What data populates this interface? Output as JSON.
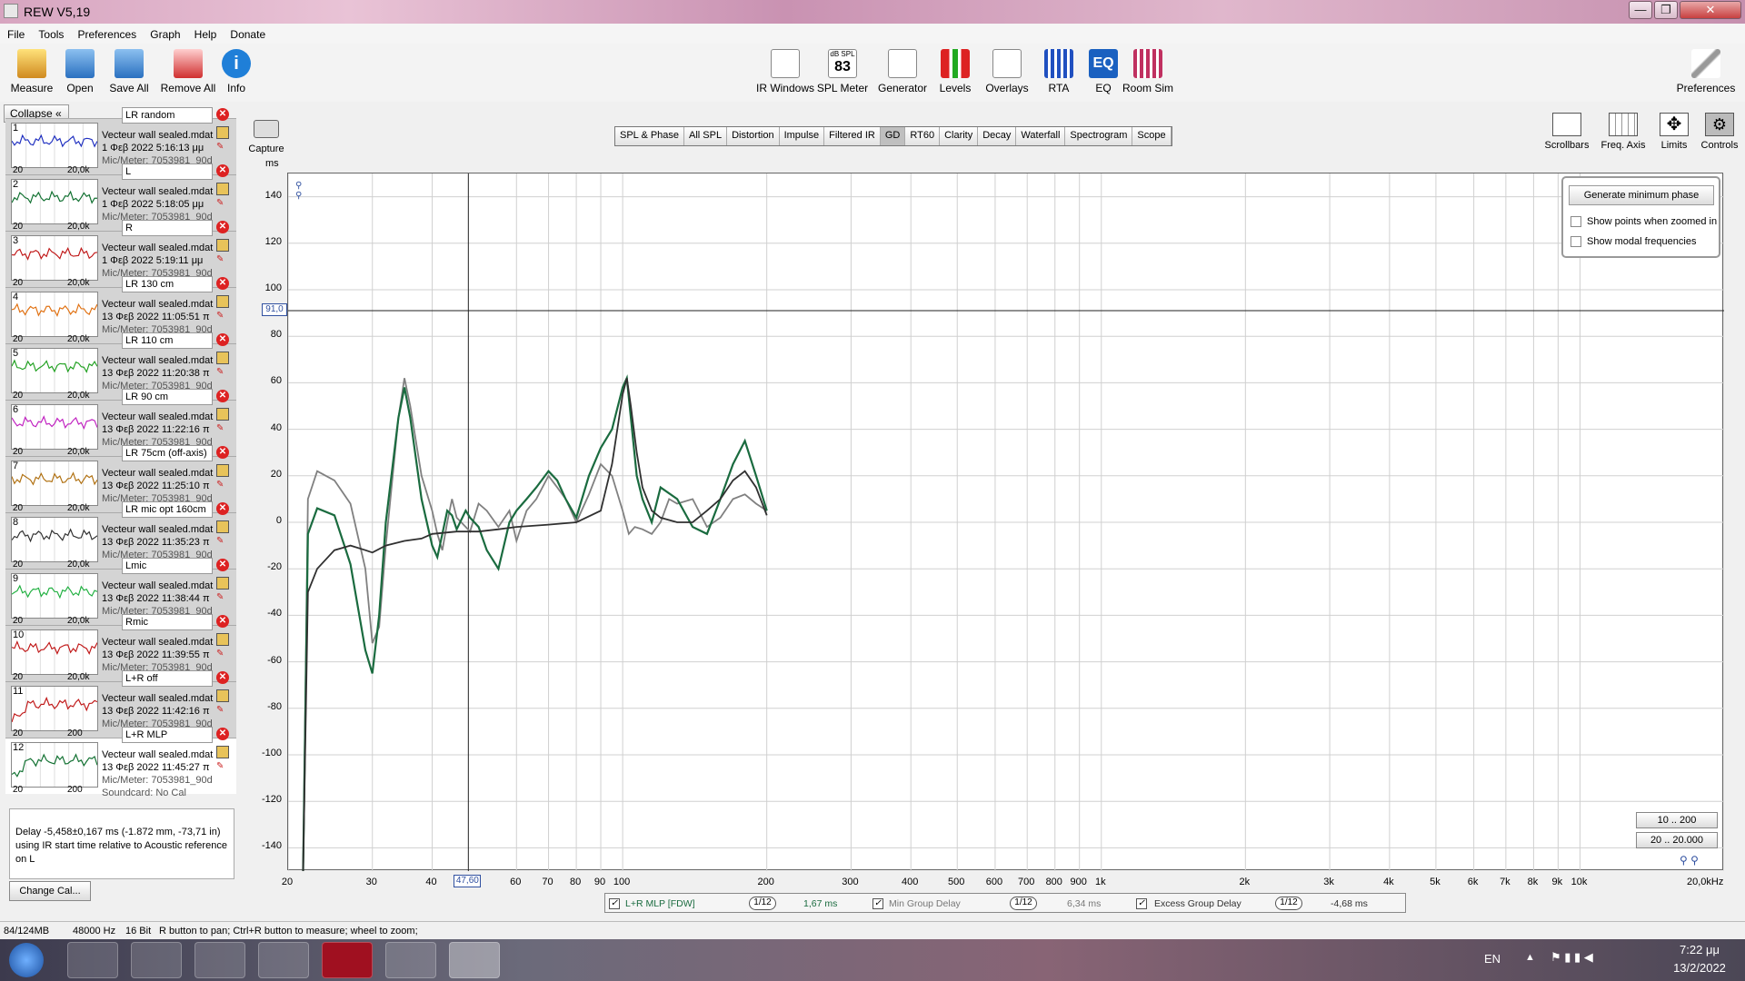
{
  "window": {
    "title": "REW V5,19",
    "min": "—",
    "max": "❐",
    "close": "✕"
  },
  "menu": [
    "File",
    "Tools",
    "Preferences",
    "Graph",
    "Help",
    "Donate"
  ],
  "toolbar_left": [
    "Measure",
    "Open",
    "Save All",
    "Remove All",
    "Info"
  ],
  "toolbar_mid": [
    "IR Windows",
    "SPL Meter",
    "Generator",
    "Levels",
    "Overlays",
    "RTA",
    "EQ",
    "Room Sim"
  ],
  "spl_meter": {
    "unit": "dB SPL",
    "value": "83"
  },
  "toolbar_right": "Preferences",
  "collapse_label": "Collapse",
  "measurements": [
    {
      "num": "1",
      "name": "LR random",
      "file": "Vecteur wall sealed.mdat",
      "date": "1 Φεβ 2022 5:16:13 μμ",
      "mic": "Mic/Meter: 7053981_90d",
      "lo": "20",
      "hi": "20,0k",
      "color": "#2030c0"
    },
    {
      "num": "2",
      "name": "L",
      "file": "Vecteur wall sealed.mdat",
      "date": "1 Φεβ 2022 5:18:05 μμ",
      "mic": "Mic/Meter: 7053981_90d",
      "lo": "20",
      "hi": "20,0k",
      "color": "#107030"
    },
    {
      "num": "3",
      "name": "R",
      "file": "Vecteur wall sealed.mdat",
      "date": "1 Φεβ 2022 5:19:11 μμ",
      "mic": "Mic/Meter: 7053981_90d",
      "lo": "20",
      "hi": "20,0k",
      "color": "#c01818"
    },
    {
      "num": "4",
      "name": "LR 130 cm",
      "file": "Vecteur wall sealed.mdat",
      "date": "13 Φεβ 2022 11:05:51 π",
      "mic": "Mic/Meter: 7053981_90d",
      "lo": "20",
      "hi": "20,0k",
      "color": "#e07010"
    },
    {
      "num": "5",
      "name": "LR 110 cm",
      "file": "Vecteur wall sealed.mdat",
      "date": "13 Φεβ 2022 11:20:38 π",
      "mic": "Mic/Meter: 7053981_90d",
      "lo": "20",
      "hi": "20,0k",
      "color": "#20a020"
    },
    {
      "num": "6",
      "name": "LR 90 cm",
      "file": "Vecteur wall sealed.mdat",
      "date": "13 Φεβ 2022 11:22:16 π",
      "mic": "Mic/Meter: 7053981_90d",
      "lo": "20",
      "hi": "20,0k",
      "color": "#c020c0"
    },
    {
      "num": "7",
      "name": "LR 75cm (off-axis)",
      "file": "Vecteur wall sealed.mdat",
      "date": "13 Φεβ 2022 11:25:10 π",
      "mic": "Mic/Meter: 7053981_90d",
      "lo": "20",
      "hi": "20,0k",
      "color": "#b07010"
    },
    {
      "num": "8",
      "name": "LR mic opt 160cm",
      "file": "Vecteur wall sealed.mdat",
      "date": "13 Φεβ 2022 11:35:23 π",
      "mic": "Mic/Meter: 7053981_90d",
      "lo": "20",
      "hi": "20,0k",
      "color": "#303030"
    },
    {
      "num": "9",
      "name": "Lmic",
      "file": "Vecteur wall sealed.mdat",
      "date": "13 Φεβ 2022 11:38:44 π",
      "mic": "Mic/Meter: 7053981_90d",
      "lo": "20",
      "hi": "20,0k",
      "color": "#20b040"
    },
    {
      "num": "10",
      "name": "Rmic",
      "file": "Vecteur wall sealed.mdat",
      "date": "13 Φεβ 2022 11:39:55 π",
      "mic": "Mic/Meter: 7053981_90d",
      "lo": "20",
      "hi": "20,0k",
      "color": "#c01818"
    },
    {
      "num": "11",
      "name": "L+R  off",
      "file": "Vecteur wall sealed.mdat",
      "date": "13 Φεβ 2022 11:42:16 π",
      "mic": "Mic/Meter: 7053981_90d",
      "lo": "20",
      "hi": "200",
      "color": "#c01818"
    },
    {
      "num": "12",
      "name": "L+R MLP",
      "file": "Vecteur wall sealed.mdat",
      "date": "13 Φεβ 2022 11:45:27 π",
      "mic": "Mic/Meter: 7053981_90d",
      "soundcard": "Soundcard: No Cal",
      "lo": "20",
      "hi": "200",
      "color": "#107030"
    }
  ],
  "info_text": "Delay -5,458±0,167 ms (-1.872 mm, -73,71 in) using IR start time relative to Acoustic reference on  L",
  "change_cal": "Change Cal...",
  "capture_label": "Capture",
  "graph_tabs": [
    "SPL & Phase",
    "All SPL",
    "Distortion",
    "Impulse",
    "Filtered IR",
    "GD",
    "RT60",
    "Clarity",
    "Decay",
    "Waterfall",
    "Spectrogram",
    "Scope"
  ],
  "active_tab": "GD",
  "right_tools": [
    "Scrollbars",
    "Freq. Axis",
    "Limits",
    "Controls"
  ],
  "controls": {
    "generate": "Generate minimum phase",
    "show_points": "Show points when zoomed in",
    "show_modal": "Show modal frequencies"
  },
  "range_buttons": [
    "10 .. 200",
    "20 .. 20.000"
  ],
  "legend": {
    "s1_name": "L+R MLP [FDW]",
    "s1_smooth": "1/12",
    "s1_val": "1,67 ms",
    "s2_name": "Min Group Delay",
    "s2_smooth": "1/12",
    "s2_val": "6,34 ms",
    "s3_name": "Excess Group Delay",
    "s3_smooth": "1/12",
    "s3_val": "-4,68 ms"
  },
  "status": {
    "mem": "84/124MB",
    "rate": "48000 Hz",
    "bits": "16 Bit",
    "hint": "R button to pan; Ctrl+R button to measure; wheel to zoom;"
  },
  "taskbar": {
    "lang": "EN",
    "time": "7:22 μμ",
    "date": "13/2/2022"
  },
  "chart_data": {
    "type": "line",
    "ylabel": "ms",
    "xlabel": "Hz",
    "xscale": "log",
    "xlim": [
      20,
      20000
    ],
    "ylim": [
      -150,
      150
    ],
    "yticks": [
      140,
      120,
      100,
      80,
      60,
      40,
      20,
      0,
      -20,
      -40,
      -60,
      -80,
      -100,
      -120,
      -140
    ],
    "xticks": [
      {
        "v": 20,
        "l": "20"
      },
      {
        "v": 30,
        "l": "30"
      },
      {
        "v": 40,
        "l": "40"
      },
      {
        "v": 60,
        "l": "60"
      },
      {
        "v": 70,
        "l": "70"
      },
      {
        "v": 80,
        "l": "80"
      },
      {
        "v": 90,
        "l": "90"
      },
      {
        "v": 100,
        "l": "100"
      },
      {
        "v": 200,
        "l": "200"
      },
      {
        "v": 300,
        "l": "300"
      },
      {
        "v": 400,
        "l": "400"
      },
      {
        "v": 500,
        "l": "500"
      },
      {
        "v": 600,
        "l": "600"
      },
      {
        "v": 700,
        "l": "700"
      },
      {
        "v": 800,
        "l": "800"
      },
      {
        "v": 900,
        "l": "900"
      },
      {
        "v": 1000,
        "l": "1k"
      },
      {
        "v": 2000,
        "l": "2k"
      },
      {
        "v": 3000,
        "l": "3k"
      },
      {
        "v": 4000,
        "l": "4k"
      },
      {
        "v": 5000,
        "l": "5k"
      },
      {
        "v": 6000,
        "l": "6k"
      },
      {
        "v": 7000,
        "l": "7k"
      },
      {
        "v": 8000,
        "l": "8k"
      },
      {
        "v": 9000,
        "l": "9k"
      },
      {
        "v": 10000,
        "l": "10k"
      },
      {
        "v": 20000,
        "l": "20,0kHz"
      }
    ],
    "cursor": {
      "x_label": "47,60",
      "x": 47.6,
      "y_label": "91,0",
      "y": 91
    },
    "series": [
      {
        "color": "#808080",
        "x": [
          21.5,
          22,
          23,
          25,
          27,
          29,
          30,
          31,
          32,
          34,
          35,
          36,
          38,
          40,
          41,
          42,
          43,
          44,
          45,
          47,
          48,
          50,
          52,
          55,
          58,
          60,
          63,
          66,
          70,
          73,
          76,
          80,
          85,
          90,
          95,
          100,
          103,
          106,
          110,
          115,
          120,
          125,
          130,
          140,
          150,
          160,
          170,
          180,
          190,
          200
        ],
        "y": [
          -150,
          10,
          22,
          18,
          8,
          -20,
          -52,
          -45,
          -10,
          45,
          62,
          50,
          20,
          5,
          -5,
          -12,
          0,
          10,
          2,
          -2,
          -4,
          8,
          5,
          -2,
          5,
          -8,
          5,
          10,
          20,
          15,
          10,
          0,
          12,
          25,
          20,
          5,
          -5,
          -2,
          -3,
          -5,
          0,
          10,
          8,
          10,
          -2,
          2,
          10,
          12,
          8,
          5
        ]
      },
      {
        "color": "#1a6b3f",
        "x": [
          21.5,
          22,
          23,
          25,
          27,
          29,
          30,
          31,
          32,
          34,
          35,
          36,
          38,
          40,
          41,
          42,
          43,
          44,
          45,
          47,
          48,
          50,
          52,
          55,
          58,
          60,
          63,
          66,
          70,
          73,
          76,
          80,
          85,
          90,
          95,
          100,
          102,
          104,
          107,
          110,
          115,
          120,
          130,
          140,
          150,
          160,
          170,
          180,
          190,
          200
        ],
        "y": [
          -150,
          -5,
          6,
          3,
          -18,
          -55,
          -65,
          -40,
          0,
          45,
          58,
          45,
          10,
          -10,
          -15,
          -5,
          5,
          3,
          -3,
          5,
          2,
          -2,
          -12,
          -20,
          0,
          5,
          10,
          15,
          22,
          18,
          10,
          2,
          20,
          32,
          40,
          58,
          62,
          45,
          20,
          10,
          0,
          15,
          10,
          -2,
          -5,
          10,
          25,
          35,
          20,
          5
        ]
      },
      {
        "color": "#303030",
        "x": [
          21.5,
          22,
          23,
          25,
          27,
          29,
          30,
          32,
          35,
          38,
          40,
          45,
          50,
          55,
          60,
          70,
          80,
          90,
          95,
          100,
          102,
          104,
          107,
          110,
          115,
          120,
          130,
          140,
          150,
          160,
          170,
          180,
          190,
          200
        ],
        "y": [
          -150,
          -30,
          -20,
          -12,
          -10,
          -12,
          -13,
          -10,
          -8,
          -7,
          -5,
          -4,
          -4,
          -3,
          -2,
          -1,
          0,
          5,
          25,
          55,
          62,
          50,
          30,
          15,
          5,
          2,
          0,
          0,
          5,
          10,
          18,
          22,
          15,
          3
        ]
      }
    ]
  }
}
